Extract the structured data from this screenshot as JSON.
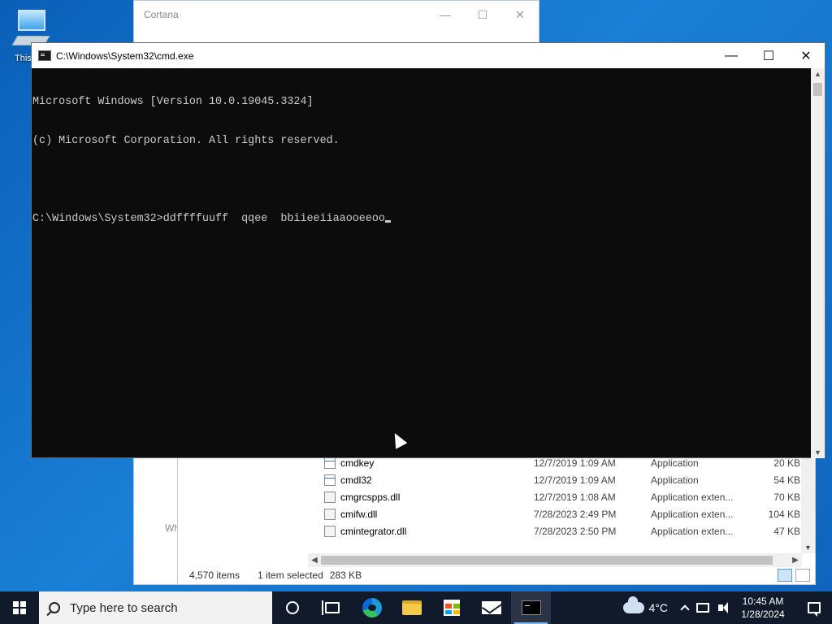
{
  "desktop": {
    "icon_label": "This"
  },
  "cortana": {
    "title": "Cortana",
    "partial_text": "Wh"
  },
  "cmd": {
    "title": "C:\\Windows\\System32\\cmd.exe",
    "lines": [
      "Microsoft Windows [Version 10.0.19045.3324]",
      "(c) Microsoft Corporation. All rights reserved.",
      "",
      "C:\\Windows\\System32>ddffffuuff  qqee  bbiieeiiaaooeeoo"
    ]
  },
  "explorer": {
    "files": [
      {
        "name": "cmdkey",
        "date": "12/7/2019 1:09 AM",
        "type": "Application",
        "size": "20 KB",
        "icon": "app-icon"
      },
      {
        "name": "cmdl32",
        "date": "12/7/2019 1:09 AM",
        "type": "Application",
        "size": "54 KB",
        "icon": "app-icon"
      },
      {
        "name": "cmgrcspps.dll",
        "date": "12/7/2019 1:08 AM",
        "type": "Application exten...",
        "size": "70 KB",
        "icon": "dll-icon"
      },
      {
        "name": "cmifw.dll",
        "date": "7/28/2023 2:49 PM",
        "type": "Application exten...",
        "size": "104 KB",
        "icon": "dll-icon"
      },
      {
        "name": "cmintegrator.dll",
        "date": "7/28/2023 2:50 PM",
        "type": "Application exten...",
        "size": "47 KB",
        "icon": "dll-icon"
      }
    ],
    "status": {
      "items": "4,570 items",
      "selected": "1 item selected",
      "size": "283 KB"
    }
  },
  "taskbar": {
    "search_placeholder": "Type here to search",
    "weather": "4°C",
    "time": "10:45 AM",
    "date": "1/28/2024"
  }
}
